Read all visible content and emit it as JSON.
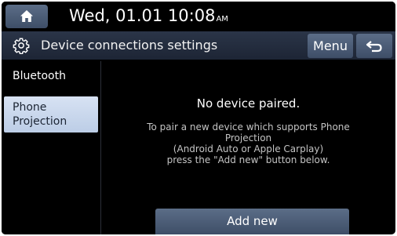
{
  "status_bar": {
    "date_time": "Wed, 01.01  10:08",
    "ampm": "AM",
    "home_icon": "home-icon"
  },
  "header": {
    "title": "Device connections settings",
    "menu_label": "Menu",
    "gear_icon": "gear-icon",
    "back_icon": "back-arrow-icon"
  },
  "sidebar": {
    "items": [
      {
        "label": "Bluetooth",
        "selected": false
      },
      {
        "label": "Phone\nProjection",
        "selected": true
      }
    ]
  },
  "main": {
    "heading": "No device paired.",
    "instructions": [
      "To pair a new device which supports Phone",
      "Projection",
      "(Android Auto or Apple Carplay)",
      "press the \"Add new\" button below."
    ],
    "add_button": "Add new"
  },
  "colors": {
    "button": "#4d5e79",
    "header": "#262f41",
    "selected_item": "#c9d7ec",
    "background": "#000000"
  }
}
